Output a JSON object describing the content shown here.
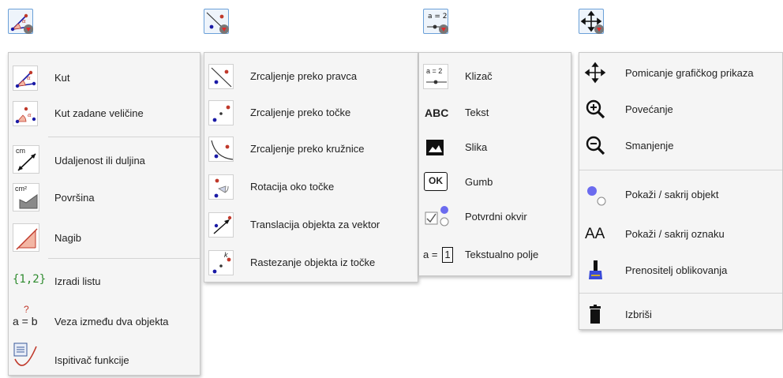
{
  "toolbar": {
    "buttons": [
      {
        "name": "angle-tool-button",
        "icon": "angle-icon"
      },
      {
        "name": "reflect-tool-button",
        "icon": "reflect-about-line-icon"
      },
      {
        "name": "slider-tool-button",
        "icon": "slider-icon"
      },
      {
        "name": "move-view-tool-button",
        "icon": "move-graphics-view-icon"
      }
    ],
    "dropdown_arrow_icon": "triangle-down-icon",
    "slider_label": "a = 2"
  },
  "menus": {
    "measure": {
      "items": [
        {
          "label": "Kut",
          "icon": "angle-icon"
        },
        {
          "label": "Kut zadane veličine",
          "icon": "angle-fixed-size-icon"
        },
        {
          "label": "Udaljenost ili duljina",
          "icon": "distance-icon"
        },
        {
          "label": "Površina",
          "icon": "area-icon"
        },
        {
          "label": "Nagib",
          "icon": "slope-icon"
        },
        {
          "label": "Izradi listu",
          "icon": "create-list-icon"
        },
        {
          "label": "Veza između dva objekta",
          "icon": "relation-icon"
        },
        {
          "label": "Ispitivač funkcije",
          "icon": "function-inspector-icon"
        }
      ],
      "icon_text": {
        "cm": "cm",
        "cm2": "cm²",
        "list": "{1,2}",
        "q": "?",
        "ab": "a = b"
      }
    },
    "transform": {
      "items": [
        {
          "label": "Zrcaljenje preko pravca",
          "icon": "reflect-about-line-icon"
        },
        {
          "label": "Zrcaljenje preko točke",
          "icon": "reflect-about-point-icon"
        },
        {
          "label": "Zrcaljenje preko kružnice",
          "icon": "reflect-about-circle-icon"
        },
        {
          "label": "Rotacija oko točke",
          "icon": "rotate-around-point-icon"
        },
        {
          "label": "Translacija objekta za vektor",
          "icon": "translate-by-vector-icon"
        },
        {
          "label": "Rastezanje objekta iz točke",
          "icon": "dilate-from-point-icon"
        }
      ],
      "icon_text": {
        "k": "k"
      }
    },
    "objects": {
      "items": [
        {
          "label": "Klizač",
          "icon": "slider-icon"
        },
        {
          "label": "Tekst",
          "icon": "text-icon"
        },
        {
          "label": "Slika",
          "icon": "image-icon"
        },
        {
          "label": "Gumb",
          "icon": "button-icon"
        },
        {
          "label": "Potvrdni okvir",
          "icon": "checkbox-icon"
        },
        {
          "label": "Tekstualno polje",
          "icon": "input-box-icon"
        }
      ],
      "icon_text": {
        "slider": "a = 2",
        "abc": "ABC",
        "ok": "OK",
        "a": "a ="
      }
    },
    "general": {
      "items": [
        {
          "label": "Pomicanje grafičkog prikaza",
          "icon": "move-graphics-view-icon"
        },
        {
          "label": "Povećanje",
          "icon": "zoom-in-icon"
        },
        {
          "label": "Smanjenje",
          "icon": "zoom-out-icon"
        },
        {
          "label": "Pokaži / sakrij objekt",
          "icon": "show-hide-object-icon"
        },
        {
          "label": "Pokaži / sakrij oznaku",
          "icon": "show-hide-label-icon"
        },
        {
          "label": "Prenositelj oblikovanja",
          "icon": "copy-visual-style-icon"
        },
        {
          "label": "Izbriši",
          "icon": "delete-icon"
        }
      ],
      "icon_text": {
        "AA": "AA"
      }
    }
  },
  "colors": {
    "accent_blue": "#1a1aa6",
    "point_red": "#c0392b",
    "selected_border": "#6aa0d8",
    "menu_bg": "#f5f5f5",
    "list_green": "#2e8b2e"
  }
}
